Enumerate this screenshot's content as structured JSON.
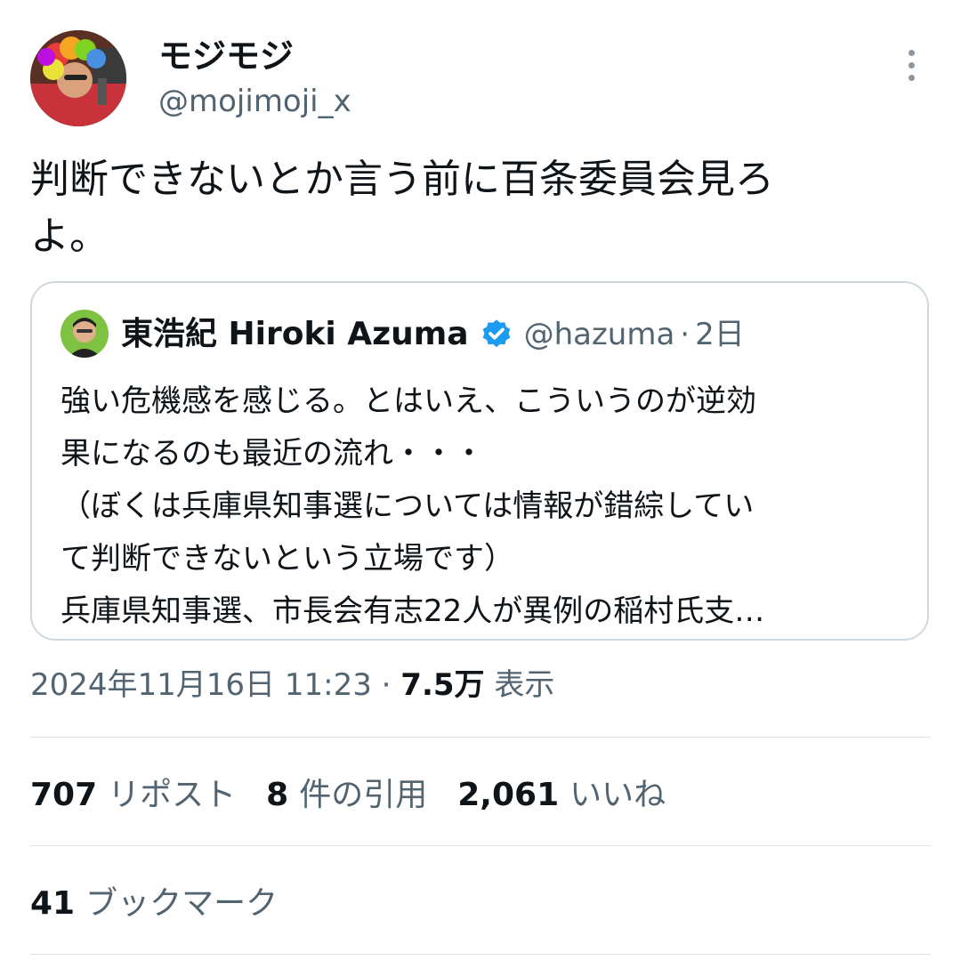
{
  "user": {
    "name": "モジモジ",
    "handle": "@mojimoji_x"
  },
  "tweet": {
    "text": "判断できないとか言う前に百条委員会見ろ\nよ。"
  },
  "quote": {
    "name": "東浩紀 Hiroki Azuma",
    "handle": "@hazuma",
    "separator": "·",
    "time": "2日",
    "body": "強い危機感を感じる。とはいえ、こういうのが逆効\n果になるのも最近の流れ・・・\n（ぼくは兵庫県知事選については情報が錯綜してい\nて判断できないという立場です）\n兵庫県知事選、市長会有志22人が異例の稲村氏支…"
  },
  "meta": {
    "timestamp": "2024年11月16日 11:23",
    "separator": "·",
    "views_count": "7.5万",
    "views_label": "表示"
  },
  "stats": {
    "reposts": {
      "num": "707",
      "label": "リポスト"
    },
    "quotes": {
      "num": "8",
      "label": "件の引用"
    },
    "likes": {
      "num": "2,061",
      "label": "いいね"
    },
    "bookmarks": {
      "num": "41",
      "label": "ブックマーク"
    }
  },
  "colors": {
    "text": "#0f1419",
    "secondary": "#536471",
    "border": "#cfd9de",
    "verified": "#1d9bf0"
  },
  "icons": {
    "more": "more-vertical-icon",
    "verified": "verified-badge-icon"
  }
}
